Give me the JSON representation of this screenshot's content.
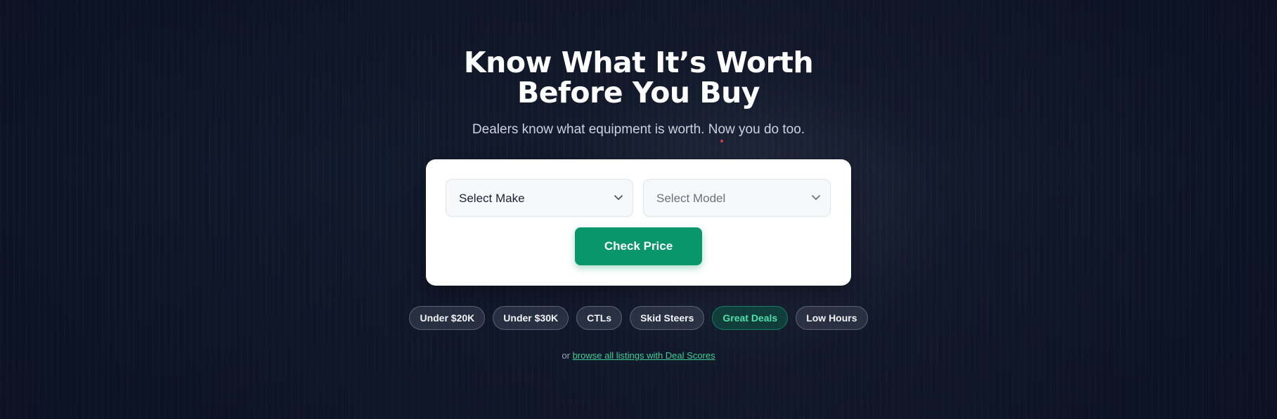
{
  "hero": {
    "headline_line1": "Know What It’s Worth",
    "headline_line2": "Before You Buy",
    "subtitle": "Dealers know what equipment is worth. Now you do too."
  },
  "search": {
    "make_placeholder": "Select Make",
    "model_placeholder": "Select Model",
    "submit_label": "Check Price"
  },
  "quick_filters": [
    {
      "label": "Under $20K",
      "active": false
    },
    {
      "label": "Under $30K",
      "active": false
    },
    {
      "label": "CTLs",
      "active": false
    },
    {
      "label": "Skid Steers",
      "active": false
    },
    {
      "label": "Great Deals",
      "active": true
    },
    {
      "label": "Low Hours",
      "active": false
    }
  ],
  "browse": {
    "prefix": "or",
    "link_text": "browse all listings with Deal Scores"
  },
  "colors": {
    "accent": "#08966a",
    "page_background": "#111a2e",
    "link": "#3ecf94"
  },
  "icons": {
    "dropdown": "chevron-down-icon"
  }
}
